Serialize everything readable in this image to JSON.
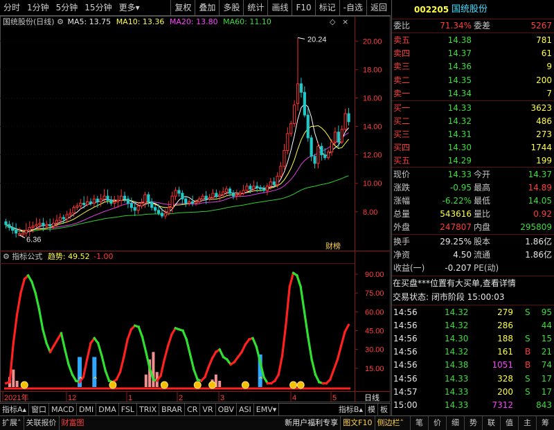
{
  "toolbar": {
    "left": [
      "分时",
      "1分钟",
      "5分钟",
      "15分钟",
      "更多"
    ],
    "right": [
      "复权",
      "叠加",
      "多股",
      "统计",
      "画线",
      "F10",
      "标记",
      "-自选",
      "返回"
    ]
  },
  "stock": {
    "code": "002205",
    "name": "国统股份"
  },
  "main_title": {
    "name": "国统股份(日线)",
    "ma5": "MA5: 13.75",
    "ma10": "MA10: 13.36",
    "ma20": "MA20: 13.80",
    "ma60": "MA60: 11.10",
    "high_label": "20.24",
    "low_label": "6.36",
    "badge": "财榜"
  },
  "main_axis": [
    "20.00",
    "18.00",
    "16.00",
    "14.00",
    "12.00",
    "10.00",
    "8.00"
  ],
  "indicator": {
    "name": "指标公式",
    "label": "趋势:",
    "value": "49.52",
    "extra": "-1.00"
  },
  "ind_axis": [
    "90.00",
    "75.00",
    "60.00",
    "45.00",
    "30.00",
    "15.00"
  ],
  "date_axis": [
    "2021年",
    "12",
    "1",
    "2",
    "3",
    "4",
    "5",
    "日线"
  ],
  "bottom_tabs": [
    "指标A",
    "窗口",
    "MACD",
    "DMI",
    "DMA",
    "FSL",
    "TRIX",
    "BRAR",
    "CR",
    "VR",
    "OBV",
    "ASI",
    "EMV",
    "指标B",
    "模",
    "板"
  ],
  "status_left": [
    "扩展",
    "关联报价",
    "财富图"
  ],
  "status_mid": [
    "新用户福利专享",
    "图文F10",
    "侧边栏"
  ],
  "status_right": [
    "笔",
    "价",
    "细",
    "势",
    "联",
    "值",
    "主",
    "筹"
  ],
  "quote": {
    "wb_label": "委比",
    "wb_value": "71.34%",
    "wc_label": "委差",
    "wc_value": "5267",
    "sell": [
      [
        "卖五",
        "14.38",
        "781"
      ],
      [
        "卖四",
        "14.37",
        "61"
      ],
      [
        "卖三",
        "14.36",
        "9"
      ],
      [
        "卖二",
        "14.35",
        "200"
      ],
      [
        "卖一",
        "14.34",
        "7"
      ]
    ],
    "buy": [
      [
        "买一",
        "14.33",
        "3623"
      ],
      [
        "买二",
        "14.32",
        "486"
      ],
      [
        "买三",
        "14.31",
        "273"
      ],
      [
        "买四",
        "14.30",
        "1744"
      ],
      [
        "买五",
        "14.29",
        "199"
      ]
    ],
    "stats": [
      [
        "现价",
        "14.33",
        "今开",
        "14.37"
      ],
      [
        "涨跌",
        "-0.95",
        "最高",
        "14.89"
      ],
      [
        "涨幅",
        "-6.22%",
        "最低",
        "14.05"
      ],
      [
        "总量",
        "543616",
        "量比",
        "0.92"
      ],
      [
        "外盘",
        "247807",
        "内盘",
        "295809"
      ]
    ],
    "stats2": [
      [
        "换手",
        "29.25%",
        "股本",
        "1.86亿"
      ],
      [
        "净资",
        "4.50",
        "流通",
        "1.86亿"
      ],
      [
        "收益(一)",
        "-0.207",
        "PE(动)",
        ""
      ]
    ],
    "notice": "在买盘***位置有大买单,查看详情",
    "trade_state": "交易状态: 闭市阶段 15:00:03"
  },
  "ticks": [
    [
      "14:56",
      "14.32",
      "279",
      "S",
      "95"
    ],
    [
      "14:56",
      "14.32",
      "286",
      "",
      "44"
    ],
    [
      "14:56",
      "14.30",
      "188",
      "S",
      "15"
    ],
    [
      "14:56",
      "14.32",
      "161",
      "B",
      "21"
    ],
    [
      "14:56",
      "14.38",
      "1051",
      "B",
      "74"
    ],
    [
      "14:56",
      "14.33",
      "328",
      "S",
      "17"
    ],
    [
      "14:57",
      "14.33",
      "200",
      "S",
      "17"
    ],
    [
      "15:00",
      "14.33",
      "7312",
      "",
      "843"
    ]
  ],
  "chart_data": [
    {
      "type": "candlestick",
      "title": "国统股份(日线)",
      "ylim": [
        5.8,
        20.6
      ],
      "y_ticks": [
        8,
        10,
        12,
        14,
        16,
        18,
        20
      ],
      "x_labels": [
        "2021年",
        "12",
        "1",
        "2",
        "3",
        "4",
        "5"
      ],
      "annotations": {
        "high": 20.24,
        "low": 6.36
      },
      "close": [
        7.1,
        6.9,
        6.7,
        6.5,
        6.45,
        6.5,
        6.7,
        6.9,
        7.0,
        7.1,
        7.2,
        7.0,
        7.1,
        7.0,
        7.2,
        7.4,
        7.6,
        7.5,
        7.8,
        7.9,
        8.3,
        8.4,
        8.6,
        8.5,
        8.7,
        8.6,
        8.9,
        8.7,
        8.9,
        9.1,
        8.8,
        8.6,
        8.7,
        8.8,
        9.1,
        8.9,
        8.6,
        8.3,
        8.1,
        8.4,
        8.6,
        9.2,
        8.7,
        8.3,
        8.1,
        7.9,
        7.7,
        7.9,
        8.3,
        9.1,
        9.5,
        9.3,
        8.9,
        8.6,
        8.7,
        8.6,
        8.7,
        8.9,
        9.1,
        8.9,
        9.0,
        9.3,
        9.1,
        9.2,
        9.4,
        9.6,
        9.3,
        9.1,
        9.2,
        9.3,
        9.5,
        9.8,
        9.6,
        9.8,
        9.7,
        9.6,
        9.5,
        9.8,
        10.1,
        9.9,
        10.5,
        11.2,
        12.3,
        13.5,
        14.2,
        15.5,
        17.0,
        16.4,
        14.8,
        13.2,
        11.9,
        11.4,
        12.6,
        12.0,
        11.8,
        12.2,
        12.9,
        13.6,
        12.9,
        13.8,
        14.9,
        14.33
      ],
      "ma_values": {
        "MA5": 13.75,
        "MA10": 13.36,
        "MA20": 13.8,
        "MA60": 11.1
      }
    },
    {
      "type": "line",
      "title": "指标公式",
      "ylim": [
        0,
        95
      ],
      "y_ticks": [
        15,
        30,
        45,
        60,
        75,
        90
      ],
      "series": [
        {
          "name": "趋势",
          "values": [
            3,
            4,
            35,
            58,
            75,
            86,
            89,
            84,
            75,
            62,
            46,
            35,
            28,
            33,
            38,
            43,
            30,
            18,
            10,
            5,
            4,
            8,
            22,
            35,
            39,
            35,
            25,
            13,
            5,
            4,
            6,
            12,
            24,
            38,
            46,
            49,
            48,
            40,
            28,
            15,
            6,
            5,
            9,
            22,
            33,
            42,
            47,
            46,
            45,
            38,
            26,
            14,
            6,
            5,
            8,
            16,
            23,
            28,
            30,
            24,
            22,
            18,
            20,
            24,
            28,
            34,
            38,
            39,
            32,
            20,
            8,
            3,
            3,
            5,
            10,
            25,
            50,
            80,
            91,
            89,
            80,
            60,
            40,
            22,
            10,
            4,
            3,
            3,
            6,
            14,
            22,
            33,
            44,
            49.52
          ]
        }
      ]
    }
  ]
}
